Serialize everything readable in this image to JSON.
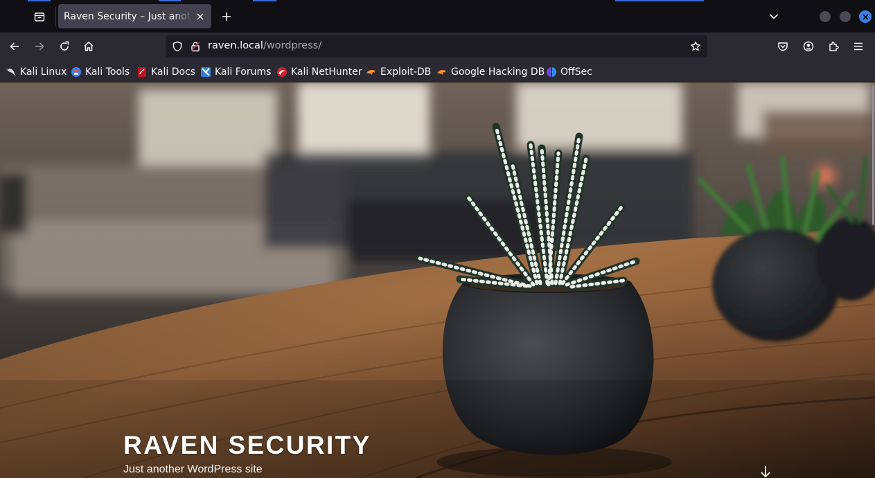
{
  "browser": {
    "tab": {
      "title": "Raven Security – Just another WordPress site"
    },
    "address_bar": {
      "host": "raven.local",
      "path": "/wordpress/"
    },
    "bookmarks": [
      {
        "label": "Kali Linux",
        "icon": "kali-dragon-icon"
      },
      {
        "label": "Kali Tools",
        "icon": "kali-tools-icon"
      },
      {
        "label": "Kali Docs",
        "icon": "kali-docs-icon"
      },
      {
        "label": "Kali Forums",
        "icon": "kali-forums-icon"
      },
      {
        "label": "Kali NetHunter",
        "icon": "kali-nethunter-icon"
      },
      {
        "label": "Exploit-DB",
        "icon": "exploit-db-icon"
      },
      {
        "label": "Google Hacking DB",
        "icon": "ghdb-icon"
      },
      {
        "label": "OffSec",
        "icon": "offsec-icon"
      }
    ],
    "colors": {
      "tab_strip": "#0f0f14",
      "toolbar": "#2b2a33",
      "url_field": "#1c1b22",
      "accent": "#3a80e8"
    }
  },
  "page": {
    "site_title": "RAVEN SECURITY",
    "site_description": "Just another WordPress site",
    "hero_image": "succulent-plant-in-dark-pot-on-wooden-table"
  }
}
